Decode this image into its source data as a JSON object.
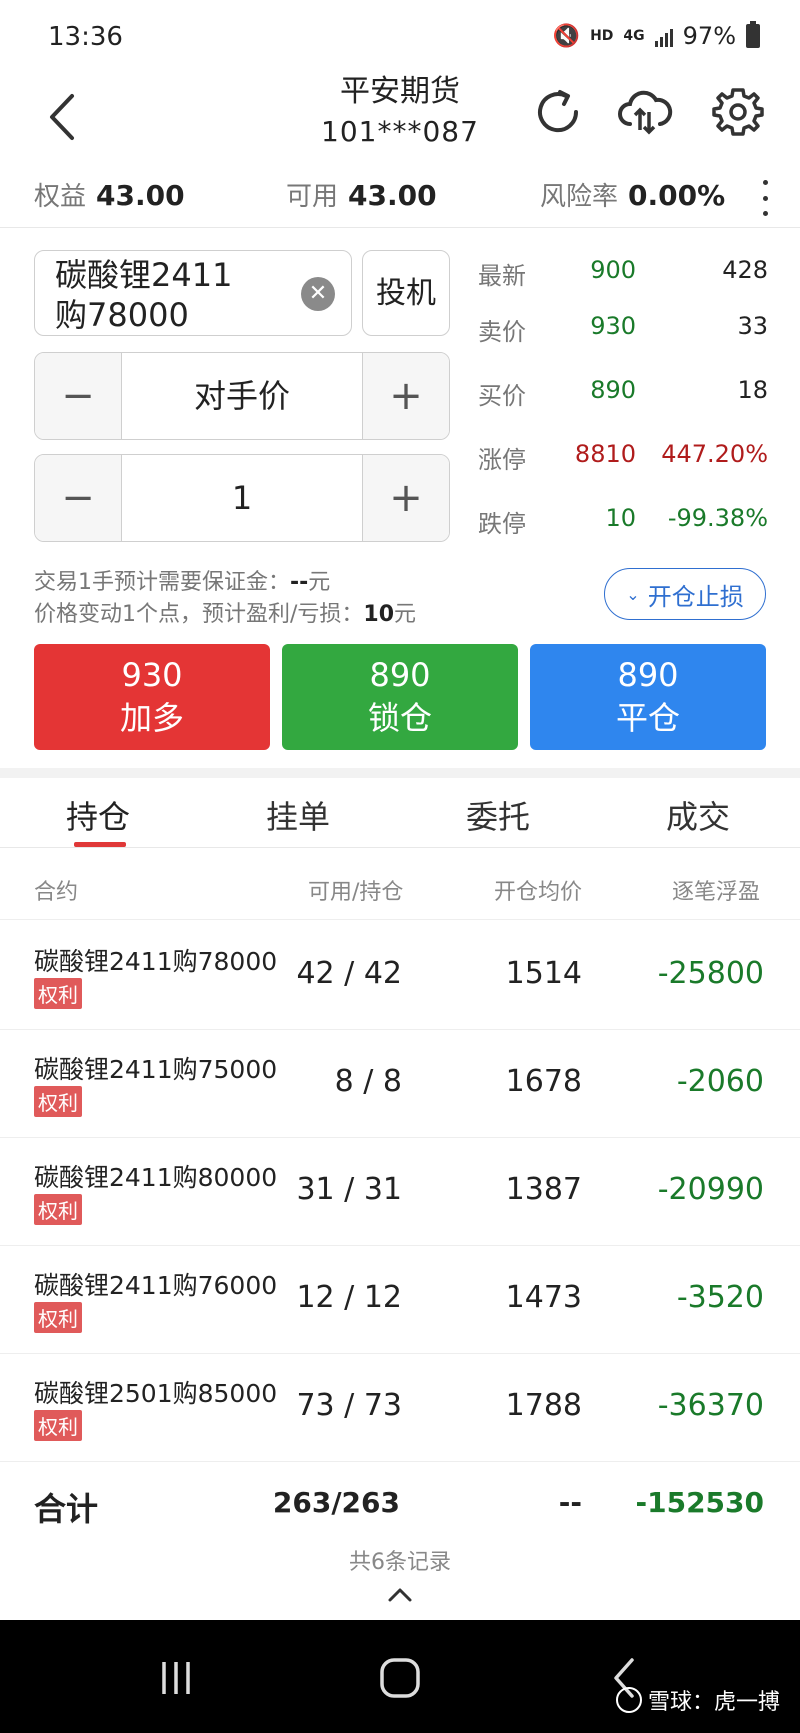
{
  "status_bar": {
    "time": "13:36",
    "hd": "HD",
    "net": "4G",
    "battery": "97%"
  },
  "header": {
    "title": "平安期货",
    "account": "101***087",
    "icons": [
      "refresh-icon",
      "cloud-sync-icon",
      "gear-icon"
    ]
  },
  "account": {
    "equity_label": "权益",
    "equity_value": "43.00",
    "available_label": "可用",
    "available_value": "43.00",
    "risk_label": "风险率",
    "risk_value": "0.00%"
  },
  "order": {
    "contract_line1": "碳酸锂2411",
    "contract_line2": "购78000",
    "spec_label": "投机",
    "price_mode": "对手价",
    "quantity": "1",
    "margin_prefix": "交易1手预计需要保证金：",
    "margin_value": "--",
    "margin_suffix": "元",
    "tick_prefix": "价格变动1个点，预计盈利/亏损：",
    "tick_value": "10",
    "tick_suffix": "元",
    "stop_button": "开仓止损"
  },
  "quotes": [
    {
      "label": "最新",
      "value": "900",
      "extra": "428",
      "vcolor": "#1a7a2a",
      "xcolor": "#222222"
    },
    {
      "label": "卖价",
      "value": "930",
      "extra": "33",
      "vcolor": "#1a7a2a",
      "xcolor": "#222222"
    },
    {
      "label": "买价",
      "value": "890",
      "extra": "18",
      "vcolor": "#1a7a2a",
      "xcolor": "#222222"
    },
    {
      "label": "涨停",
      "value": "8810",
      "extra": "447.20%",
      "vcolor": "#b01c1c",
      "xcolor": "#b01c1c"
    },
    {
      "label": "跌停",
      "value": "10",
      "extra": "-99.38%",
      "vcolor": "#1a7a2a",
      "xcolor": "#1a7a2a"
    }
  ],
  "actions": [
    {
      "price": "930",
      "label": "加多",
      "color": "#e43535"
    },
    {
      "price": "890",
      "label": "锁仓",
      "color": "#33a840"
    },
    {
      "price": "890",
      "label": "平仓",
      "color": "#2f86ee"
    }
  ],
  "tabs": [
    "持仓",
    "挂单",
    "委托",
    "成交"
  ],
  "table": {
    "headers": [
      "合约",
      "可用/持仓",
      "开仓均价",
      "逐笔浮盈"
    ],
    "rows": [
      {
        "name": "碳酸锂2411购78000",
        "badge": "权利",
        "qty": "42 / 42",
        "avg": "1514",
        "pl": "-25800"
      },
      {
        "name": "碳酸锂2411购75000",
        "badge": "权利",
        "qty": "8 / 8",
        "avg": "1678",
        "pl": "-2060"
      },
      {
        "name": "碳酸锂2411购80000",
        "badge": "权利",
        "qty": "31 / 31",
        "avg": "1387",
        "pl": "-20990"
      },
      {
        "name": "碳酸锂2411购76000",
        "badge": "权利",
        "qty": "12 / 12",
        "avg": "1473",
        "pl": "-3520"
      },
      {
        "name": "碳酸锂2501购85000",
        "badge": "权利",
        "qty": "73 / 73",
        "avg": "1788",
        "pl": "-36370"
      }
    ],
    "total": {
      "label": "合计",
      "qty": "263/263",
      "avg": "--",
      "pl": "-152530"
    },
    "records": "共6条记录"
  },
  "watermark": "雪球：虎一搏"
}
